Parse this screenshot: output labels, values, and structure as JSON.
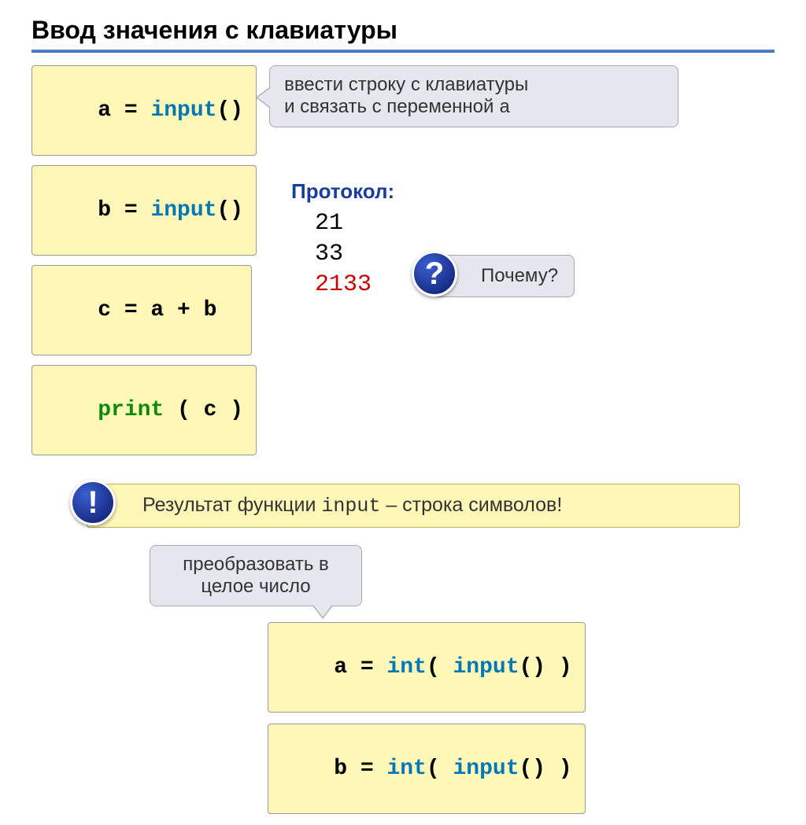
{
  "title": "Ввод значения с клавиатуры",
  "code_lines": {
    "line1": {
      "var": "a",
      "eq": " = ",
      "func": "input",
      "parens": "()"
    },
    "line2": {
      "var": "b",
      "eq": " = ",
      "func": "input",
      "parens": "()"
    },
    "line3": {
      "expr": "c = a + b"
    },
    "line4": {
      "func": "print",
      "args": " ( c )"
    }
  },
  "callout1": {
    "line1": "ввести строку с клавиатуры",
    "line2_pre": "и связать с переменной ",
    "line2_var": "a"
  },
  "protocol": {
    "title": "Протокол:",
    "v1": "21",
    "v2": "33",
    "v3": "2133"
  },
  "question": {
    "text": "Почему?"
  },
  "exclaim": {
    "pre": "Результат функции ",
    "func": "input",
    "post": " – строка символов!"
  },
  "convert": {
    "line1": "преобразовать в",
    "line2": "целое число"
  },
  "bottom": {
    "l1": {
      "var": "a",
      "eq": " = ",
      "cast": "int",
      "po": "( ",
      "func": "input",
      "parens": "()",
      "pc": " )"
    },
    "l2": {
      "var": "b",
      "eq": " = ",
      "cast": "int",
      "po": "( ",
      "func": "input",
      "parens": "()",
      "pc": " )"
    }
  }
}
